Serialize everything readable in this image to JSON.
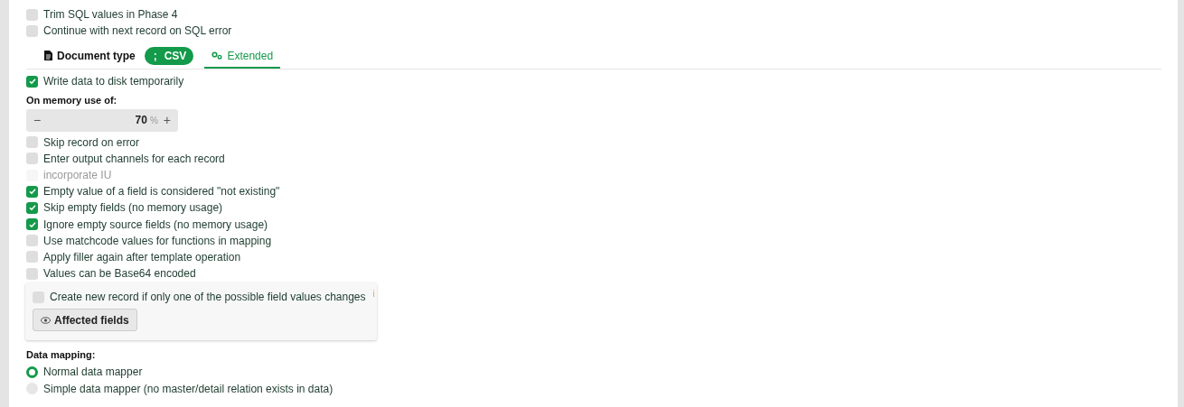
{
  "top_options": [
    {
      "label": "Trim SQL values in Phase 4",
      "checked": false,
      "disabled": false
    },
    {
      "label": "Continue with next record on SQL error",
      "checked": false,
      "disabled": false
    }
  ],
  "tabs": [
    {
      "label": "Document type",
      "selected": false,
      "badge": {
        "symbol": ";",
        "label": "CSV"
      }
    },
    {
      "label": "Extended",
      "selected": true
    }
  ],
  "write_to_disk": {
    "label": "Write data to disk temporarily",
    "checked": true,
    "disabled": false
  },
  "memory": {
    "label": "On memory use of:",
    "minus": "−",
    "value": "70",
    "unit": "%",
    "plus": "+"
  },
  "options": [
    {
      "label": "Skip record on error",
      "checked": false,
      "disabled": false
    },
    {
      "label": "Enter output channels for each record",
      "checked": false,
      "disabled": false
    },
    {
      "label": "incorporate IU",
      "checked": false,
      "disabled": true
    },
    {
      "label": "Empty value of a field is considered \"not existing\"",
      "checked": true,
      "disabled": false
    },
    {
      "label": "Skip empty fields (no memory usage)",
      "checked": true,
      "disabled": false
    },
    {
      "label": "Ignore empty source fields (no memory usage)",
      "checked": true,
      "disabled": false
    },
    {
      "label": "Use matchcode values for functions in mapping",
      "checked": false,
      "disabled": false
    },
    {
      "label": "Apply filler again after template operation",
      "checked": false,
      "disabled": false
    },
    {
      "label": "Values can be Base64 encoded",
      "checked": false,
      "disabled": false
    }
  ],
  "new_record_panel": {
    "option": {
      "label": "Create new record if only one of the possible field values changes",
      "checked": false,
      "disabled": false
    },
    "info": "i",
    "button": "Affected fields"
  },
  "data_mapping": {
    "label": "Data mapping:",
    "options": [
      {
        "label": "Normal data mapper",
        "selected": true
      },
      {
        "label": "Simple data mapper (no master/detail relation exists in data)",
        "selected": false
      }
    ]
  }
}
